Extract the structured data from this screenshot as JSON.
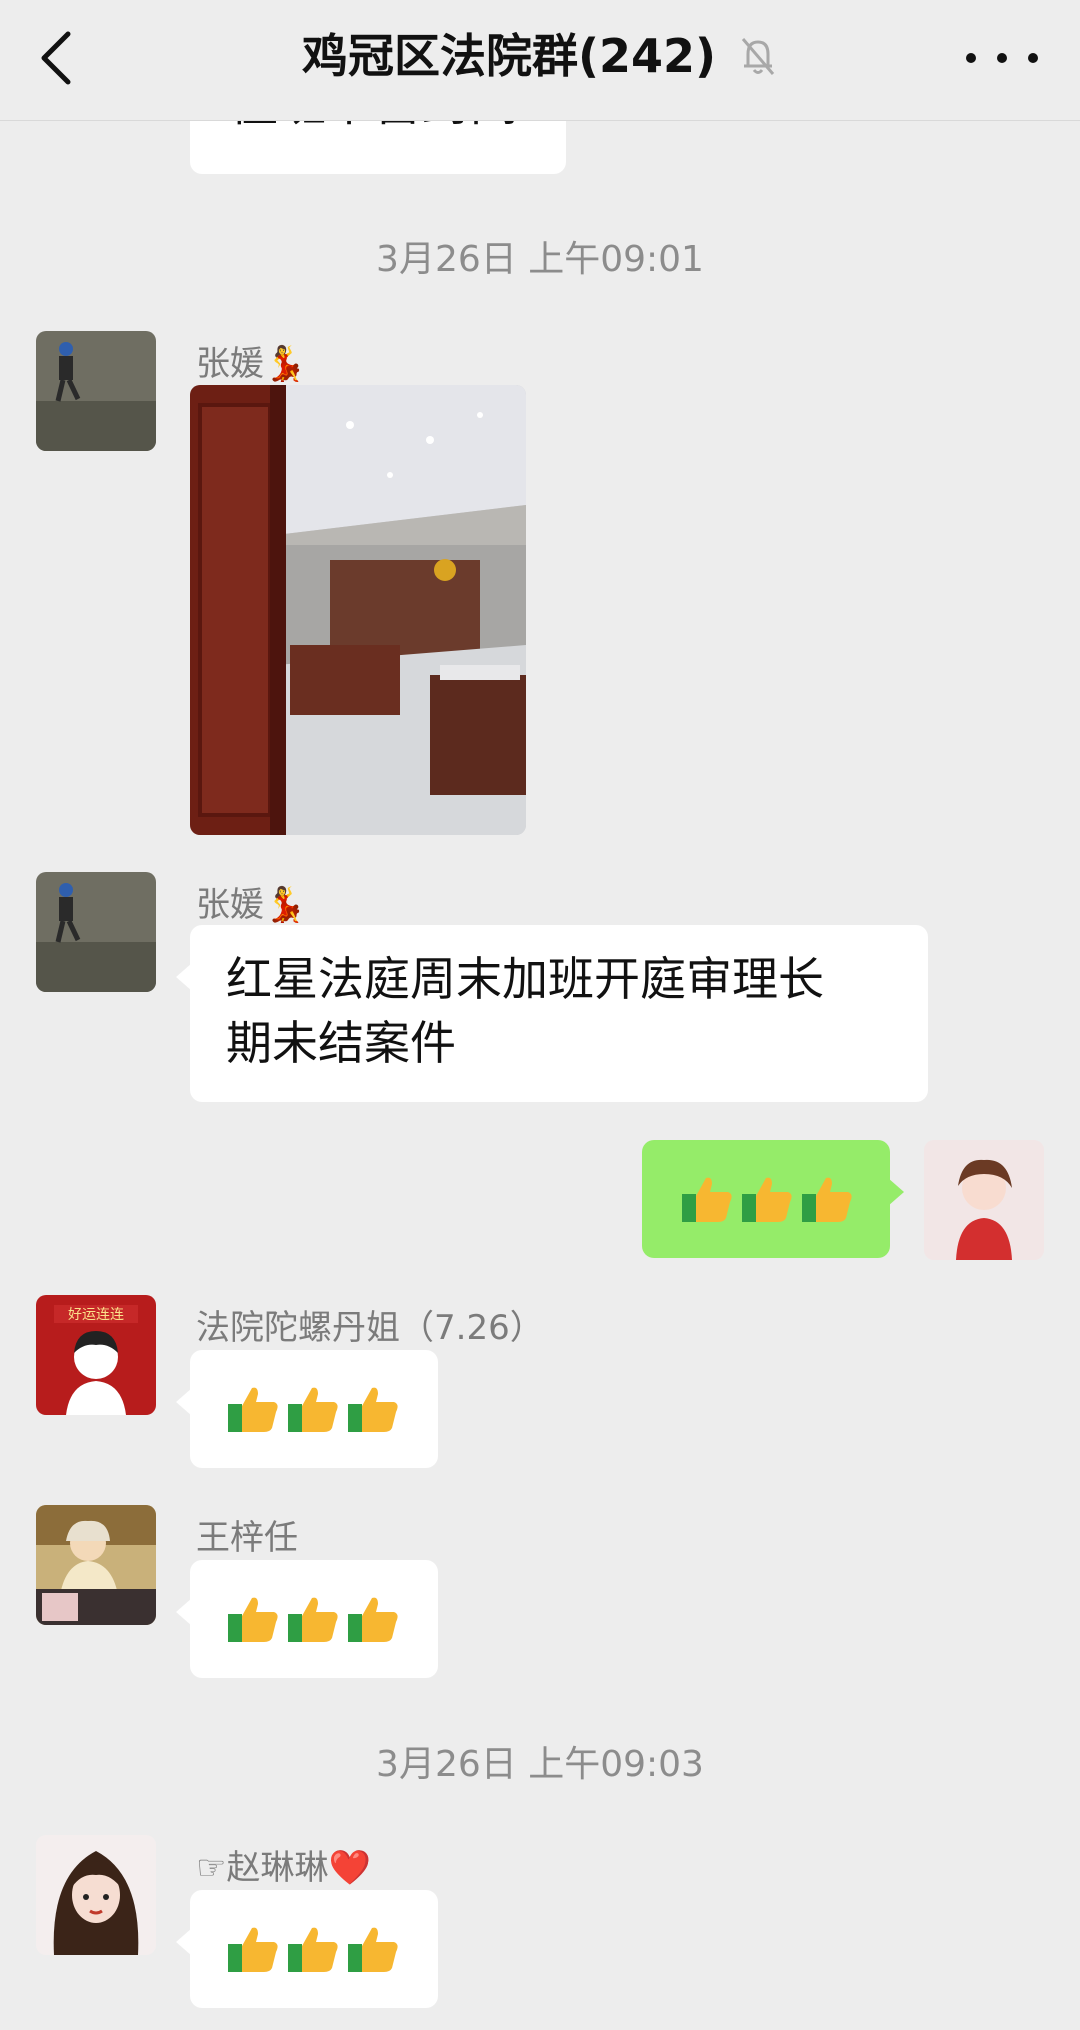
{
  "header": {
    "title": "鸡冠区法院群(242)",
    "back_icon": "chevron-left-icon",
    "mute_icon": "bell-off-icon",
    "more_icon": "more-dots-icon"
  },
  "partial_message": {
    "text": "值班下雷封闭"
  },
  "timestamps": [
    "3月26日 上午09:01",
    "3月26日 上午09:03"
  ],
  "messages": [
    {
      "sender": "张媛💃",
      "type": "image",
      "image_desc": "courtroom-photo"
    },
    {
      "sender": "张媛💃",
      "type": "text",
      "text_line1": "红星法庭周末加班开庭审理长",
      "text_line2": "期未结案件"
    },
    {
      "sender": "",
      "type": "self-thumbs",
      "text": "👍👍👍"
    },
    {
      "sender": "法院陀螺丹姐（7.26）",
      "type": "thumbs",
      "text": "👍👍👍"
    },
    {
      "sender": "王梓任",
      "type": "thumbs",
      "text": "👍👍👍"
    },
    {
      "sender": "☞赵琳琳❤️",
      "type": "thumbs",
      "text": "👍👍👍"
    }
  ],
  "colors": {
    "background": "#ededed",
    "self_bubble": "#95ec69",
    "other_bubble": "#ffffff",
    "thumb": "#f7b731"
  }
}
